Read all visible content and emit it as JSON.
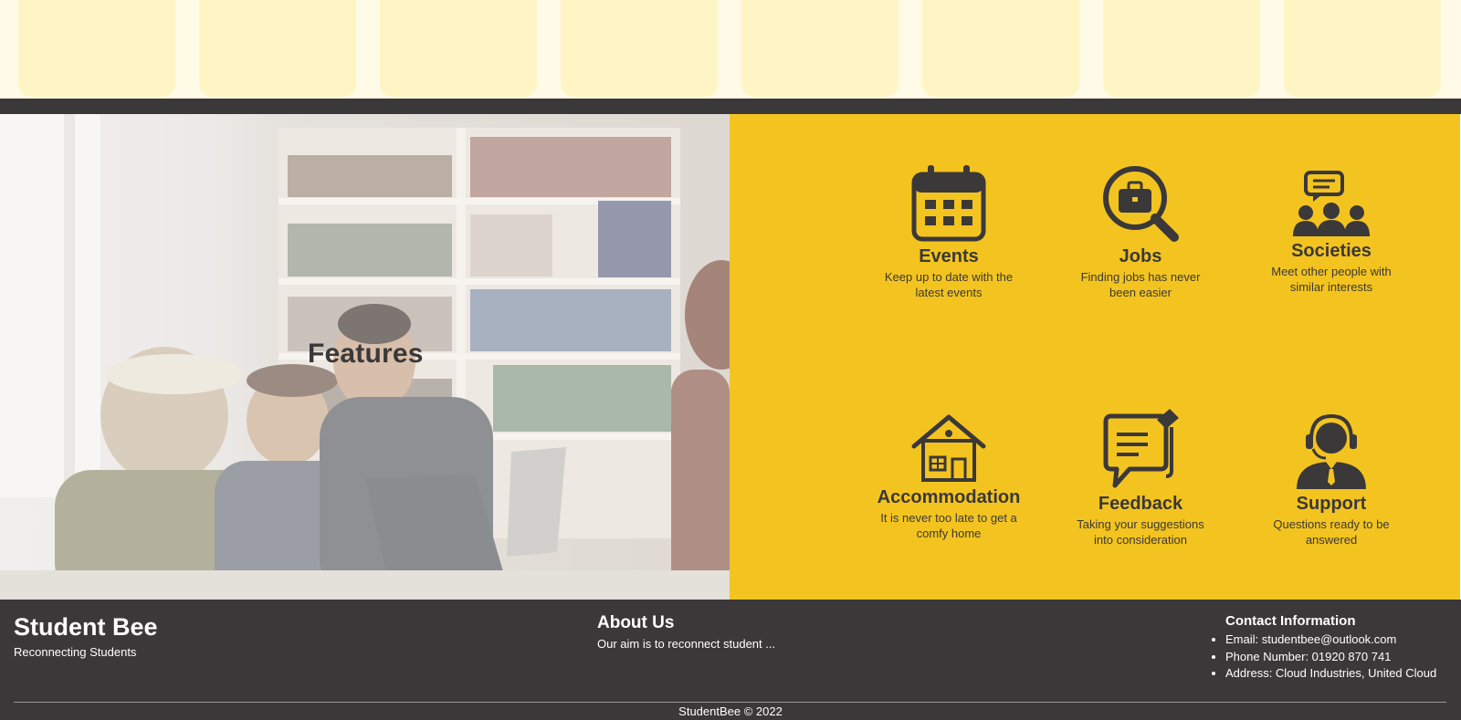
{
  "features_section": {
    "title": "Features",
    "items": [
      {
        "icon": "calendar-icon",
        "title": "Events",
        "description": "Keep up to date with the latest events"
      },
      {
        "icon": "briefcase-search-icon",
        "title": "Jobs",
        "description": "Finding jobs has never been easier"
      },
      {
        "icon": "group-chat-icon",
        "title": "Societies",
        "description": "Meet other people with similar interests"
      },
      {
        "icon": "house-icon",
        "title": "Accommodation",
        "description": "It is never too late to get a comfy home"
      },
      {
        "icon": "feedback-icon",
        "title": "Feedback",
        "description": "Taking your suggestions into consideration"
      },
      {
        "icon": "headset-agent-icon",
        "title": "Support",
        "description": "Questions ready to be answered"
      }
    ]
  },
  "footer": {
    "brand": {
      "name": "Student Bee",
      "tagline": "Reconnecting Students"
    },
    "about": {
      "title": "About Us",
      "text": "Our aim is to reconnect student ..."
    },
    "contact": {
      "title": "Contact Information",
      "items": [
        "Email: studentbee@outlook.com",
        "Phone Number: 01920 870 741",
        "Address: Cloud Industries, United Cloud"
      ]
    },
    "copyright": "StudentBee © 2022"
  },
  "colors": {
    "accent": "#f3c41f",
    "dark": "#3b3839",
    "top_strip": "#fffbe6",
    "tile": "#fff5c4"
  }
}
